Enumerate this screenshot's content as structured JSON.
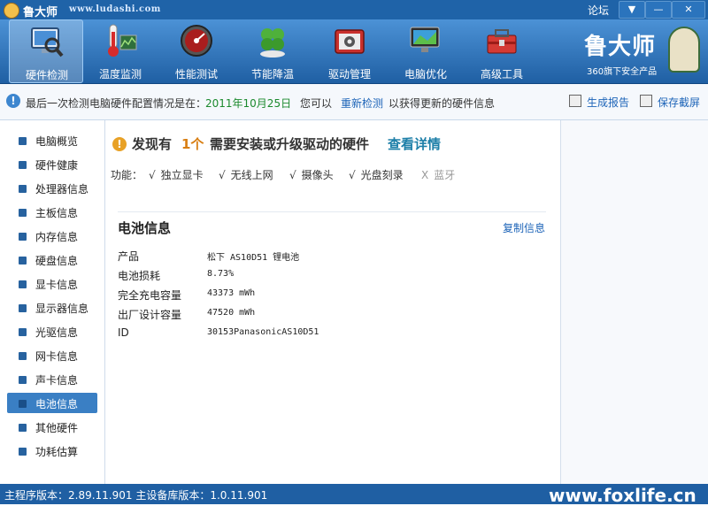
{
  "window": {
    "title": "鲁大师",
    "url": "www.ludashi.com",
    "forum_link": "论坛",
    "controls": [
      "▼",
      "—",
      "✕"
    ]
  },
  "toolbar": {
    "tools": [
      {
        "label": "硬件检测",
        "icon": "monitor-magnifier-icon"
      },
      {
        "label": "温度监测",
        "icon": "thermometer-icon"
      },
      {
        "label": "性能测试",
        "icon": "speedometer-icon"
      },
      {
        "label": "节能降温",
        "icon": "clover-icon"
      },
      {
        "label": "驱动管理",
        "icon": "driver-toolbox-icon"
      },
      {
        "label": "电脑优化",
        "icon": "desktop-optimize-icon"
      },
      {
        "label": "高级工具",
        "icon": "toolbox-icon"
      }
    ],
    "brand_name": "鲁大师",
    "brand_sub": "360旗下安全产品"
  },
  "infobar": {
    "text": "最后一次检测电脑硬件配置情况是在：",
    "date": "2011年10月25日",
    "hint": "您可以",
    "recheck": "重新检测",
    "tail": "以获得更新的硬件信息",
    "report": "生成报告",
    "screenshot": "保存截屏"
  },
  "sidebar": {
    "items": [
      {
        "label": "电脑概览"
      },
      {
        "label": "硬件健康"
      },
      {
        "label": "处理器信息"
      },
      {
        "label": "主板信息"
      },
      {
        "label": "内存信息"
      },
      {
        "label": "硬盘信息"
      },
      {
        "label": "显卡信息"
      },
      {
        "label": "显示器信息"
      },
      {
        "label": "光驱信息"
      },
      {
        "label": "网卡信息"
      },
      {
        "label": "声卡信息"
      },
      {
        "label": "电池信息"
      },
      {
        "label": "其他硬件"
      },
      {
        "label": "功耗估算"
      }
    ],
    "active_index": 11
  },
  "content": {
    "warning": {
      "prefix": "发现有",
      "count": "1个",
      "suffix": "需要安装或升级驱动的硬件",
      "link": "查看详情"
    },
    "features_label": "功能：",
    "features": [
      {
        "mark": "√",
        "label": "独立显卡",
        "supported": true
      },
      {
        "mark": "√",
        "label": "无线上网",
        "supported": true
      },
      {
        "mark": "√",
        "label": "摄像头",
        "supported": true
      },
      {
        "mark": "√",
        "label": "光盘刻录",
        "supported": true
      },
      {
        "mark": "X",
        "label": "蓝牙",
        "supported": false
      }
    ],
    "section_title": "电池信息",
    "copy_link": "复制信息",
    "specs": [
      {
        "name": "产品",
        "value": "松下 AS10D51 锂电池"
      },
      {
        "name": "电池损耗",
        "value": "8.73%"
      },
      {
        "name": "完全充电容量",
        "value": "43373 mWh"
      },
      {
        "name": "出厂设计容量",
        "value": "47520 mWh"
      },
      {
        "name": "ID",
        "value": "30153PanasonicAS10D51"
      }
    ]
  },
  "statusbar": {
    "text": "主程序版本：2.89.11.901   主设备库版本：1.0.11.901",
    "watermark": "www.foxlife.cn"
  },
  "colors": {
    "title_bar": "#1f63a8",
    "toolbar_top": "#4c92d6",
    "toolbar_bottom": "#1f5fa3",
    "active_nav": "#3a7fc4",
    "date_green": "#1c8a2e",
    "warn_count": "#d87e12",
    "link_blue": "#1d64b8"
  }
}
